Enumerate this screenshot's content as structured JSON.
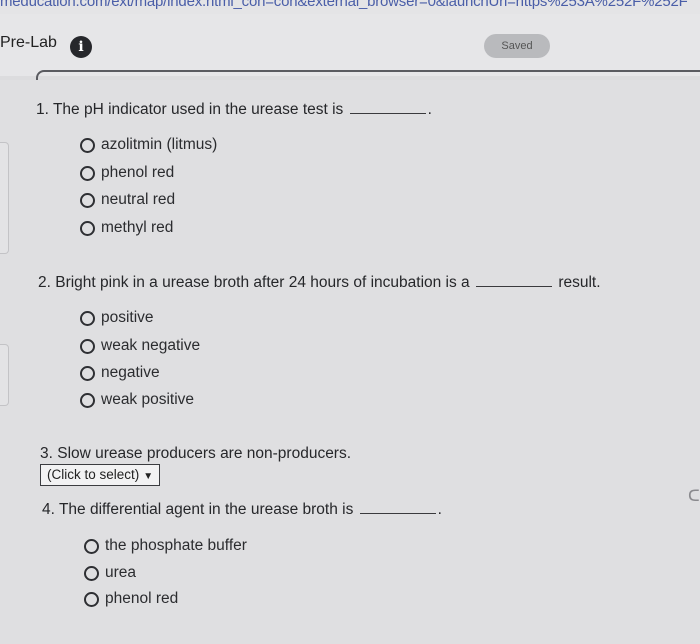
{
  "browser": {
    "url_fragment": "meducation.com/ext/map/index.html_con=con&external_browser=0&launchUrl=https%253A%252F%252F"
  },
  "header": {
    "section_title": "Pre-Lab",
    "info_icon": "info-icon",
    "info_glyph": "i",
    "saved_badge": "Saved"
  },
  "questions": [
    {
      "prefix": "1. The pH indicator used in the urease test is",
      "suffix": ".",
      "options": [
        "azolitmin (litmus)",
        "phenol red",
        "neutral red",
        "methyl red"
      ]
    },
    {
      "prefix": "2. Bright pink in a urease broth after 24 hours of incubation is a",
      "suffix": "result.",
      "options": [
        "positive",
        "weak negative",
        "negative",
        "weak positive"
      ]
    },
    {
      "prefix": "3. Slow urease producers are non-producers.",
      "select_value": "(Click to select)",
      "select_icon": "chevron-down-icon"
    },
    {
      "prefix": "4. The differential agent in the urease broth is",
      "suffix": ".",
      "options": [
        "the phosphate buffer",
        "urea",
        "phenol red"
      ]
    }
  ],
  "side_glyph": "ᑕ"
}
